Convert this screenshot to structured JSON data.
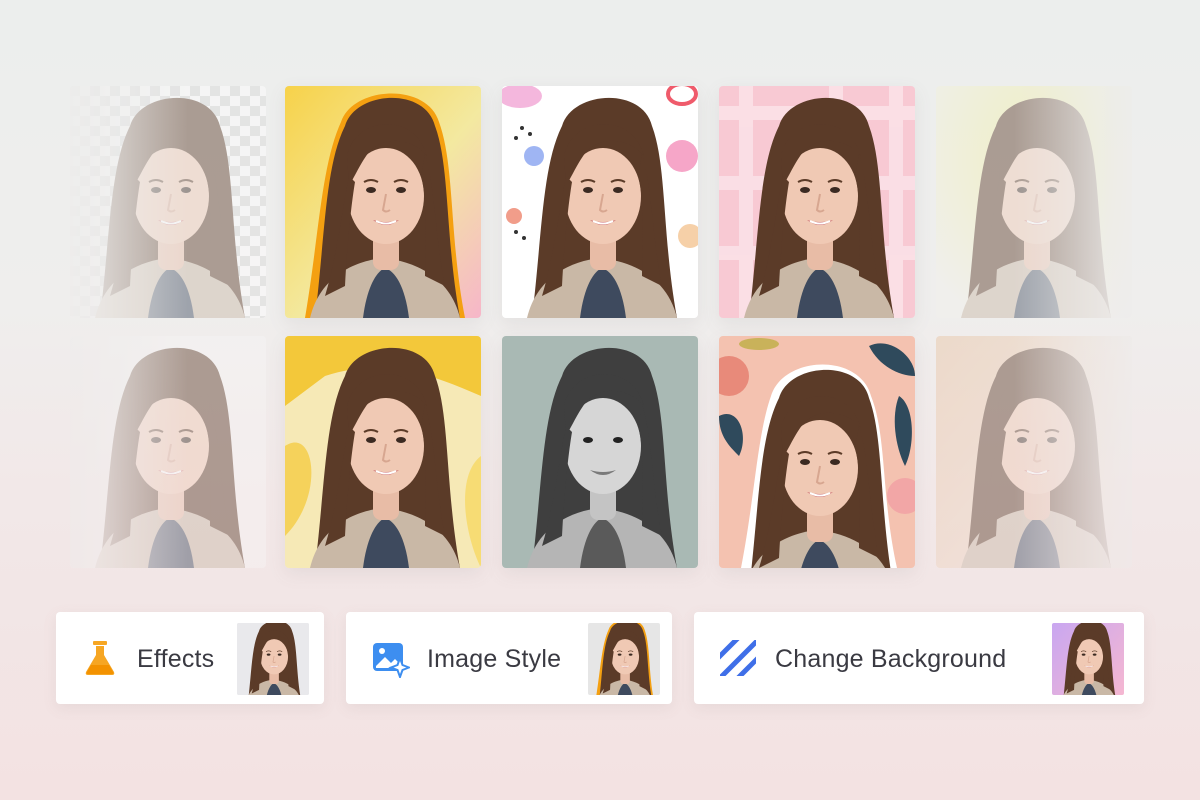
{
  "cards": {
    "effects": {
      "label": "Effects",
      "icon": "flask-icon",
      "color": "#f6a623"
    },
    "image_style": {
      "label": "Image Style",
      "icon": "image-sparkle-icon",
      "color": "#3d8ef0"
    },
    "change_background": {
      "label": "Change Background",
      "icon": "diagonal-stripes-icon",
      "color": "#3f6fe8"
    }
  },
  "tiles": [
    {
      "row": 1,
      "style": "transparent-checker"
    },
    {
      "row": 1,
      "style": "gradient-orange-outline"
    },
    {
      "row": 1,
      "style": "floral-white"
    },
    {
      "row": 1,
      "style": "pink-plaid"
    },
    {
      "row": 1,
      "style": "yellow-glow"
    },
    {
      "row": 2,
      "style": "plain-white"
    },
    {
      "row": 2,
      "style": "yellow-paint"
    },
    {
      "row": 2,
      "style": "grayscale"
    },
    {
      "row": 2,
      "style": "floral-sticker"
    },
    {
      "row": 2,
      "style": "warm-blur"
    }
  ],
  "colors": {
    "hair": "#5b3b28",
    "skin": "#f0c9b4",
    "jacket": "#c9b8a6",
    "shirt": "#3e4a5e",
    "text": "#3a3a42"
  }
}
